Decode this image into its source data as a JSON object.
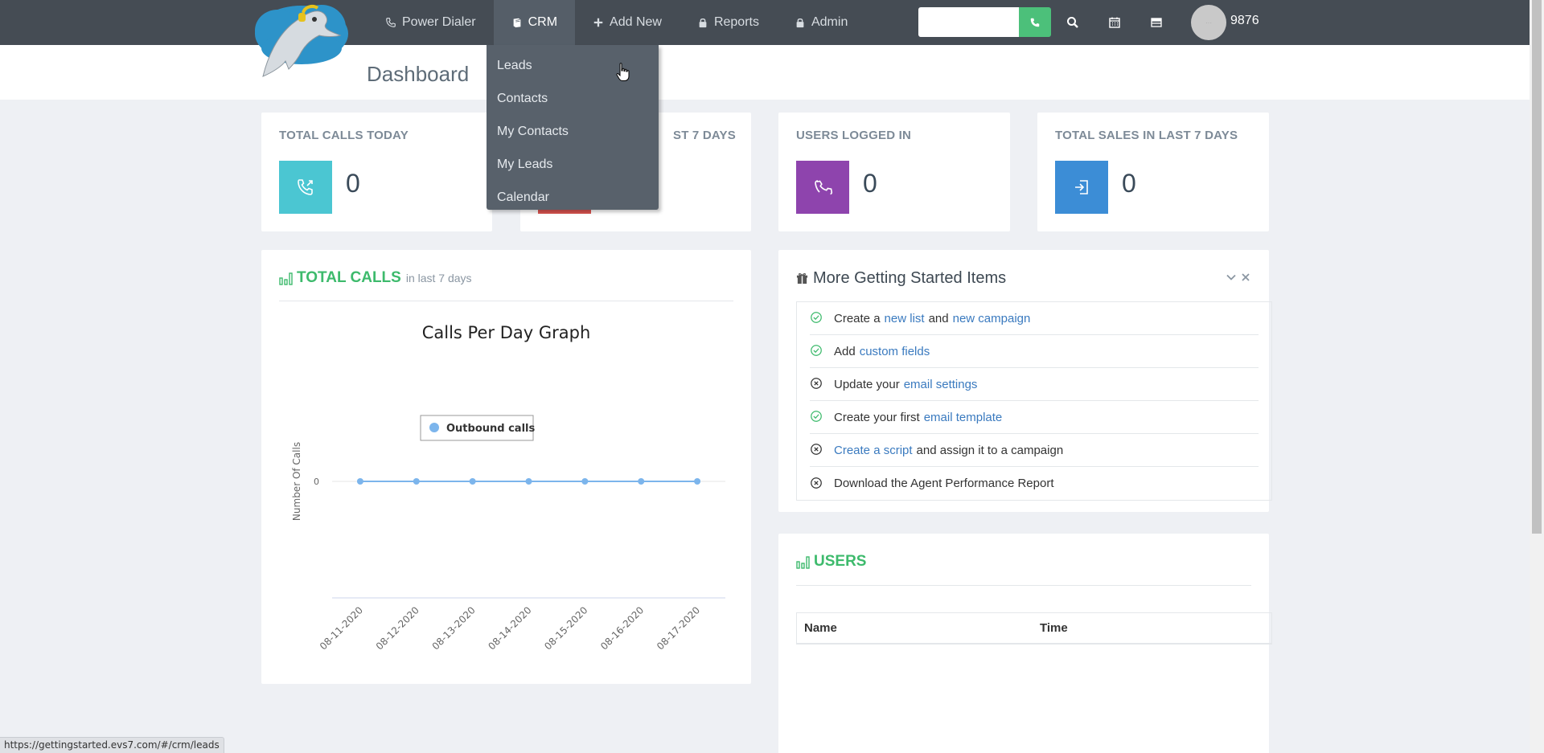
{
  "nav": {
    "items": [
      {
        "label": "Power Dialer",
        "icon": "phone-icon"
      },
      {
        "label": "CRM",
        "icon": "book-icon"
      },
      {
        "label": "Add New",
        "icon": "plus-icon"
      },
      {
        "label": "Reports",
        "icon": "lock-icon"
      },
      {
        "label": "Admin",
        "icon": "lock-icon"
      }
    ],
    "search_value": "",
    "user_extension": "9876"
  },
  "crm_dropdown": {
    "items": [
      "Leads",
      "Contacts",
      "My Contacts",
      "My Leads",
      "Calendar"
    ]
  },
  "page": {
    "title": "Dashboard"
  },
  "stats": [
    {
      "label": "TOTAL CALLS TODAY",
      "value": "0",
      "color": "#4bc6d2"
    },
    {
      "label": "ST 7 DAYS",
      "value": "",
      "color": "#d9534f"
    },
    {
      "label": "USERS LOGGED IN",
      "value": "0",
      "color": "#8e44ad"
    },
    {
      "label": "TOTAL SALES IN LAST 7 DAYS",
      "value": "0",
      "color": "#3c8dd6"
    }
  ],
  "total_calls": {
    "heading": "TOTAL CALLS",
    "subheading": "in last 7 days"
  },
  "chart_data": {
    "type": "line",
    "title": "Calls Per Day Graph",
    "ylabel": "Number Of Calls",
    "xlabel": "",
    "categories": [
      "08-11-2020",
      "08-12-2020",
      "08-13-2020",
      "08-14-2020",
      "08-15-2020",
      "08-16-2020",
      "08-17-2020"
    ],
    "series": [
      {
        "name": "Outbound calls",
        "values": [
          0,
          0,
          0,
          0,
          0,
          0,
          0
        ],
        "color": "#7cb5ec"
      }
    ],
    "yticks": [
      "0"
    ],
    "legend": "top-center"
  },
  "getting_started": {
    "title": "More Getting Started Items",
    "items": [
      {
        "done": true,
        "parts": [
          {
            "t": "Create a"
          },
          {
            "a": "new list"
          },
          {
            "t": "and"
          },
          {
            "a": "new campaign"
          }
        ]
      },
      {
        "done": true,
        "parts": [
          {
            "t": "Add"
          },
          {
            "a": "custom fields"
          }
        ]
      },
      {
        "done": false,
        "parts": [
          {
            "t": "Update your"
          },
          {
            "a": "email settings"
          }
        ]
      },
      {
        "done": true,
        "parts": [
          {
            "t": "Create your first"
          },
          {
            "a": "email template"
          }
        ]
      },
      {
        "done": false,
        "parts": [
          {
            "a": "Create a script"
          },
          {
            "t": "and assign it to a campaign"
          }
        ]
      },
      {
        "done": false,
        "parts": [
          {
            "t": "Download the Agent Performance Report"
          }
        ]
      }
    ]
  },
  "users": {
    "heading": "USERS",
    "columns": [
      "Name",
      "Time"
    ]
  },
  "status_url": "https://gettingstarted.evs7.com/#/crm/leads",
  "colors": {
    "navbar": "#454c54",
    "accent_green": "#3dba6c",
    "link_blue": "#3a7abf"
  }
}
